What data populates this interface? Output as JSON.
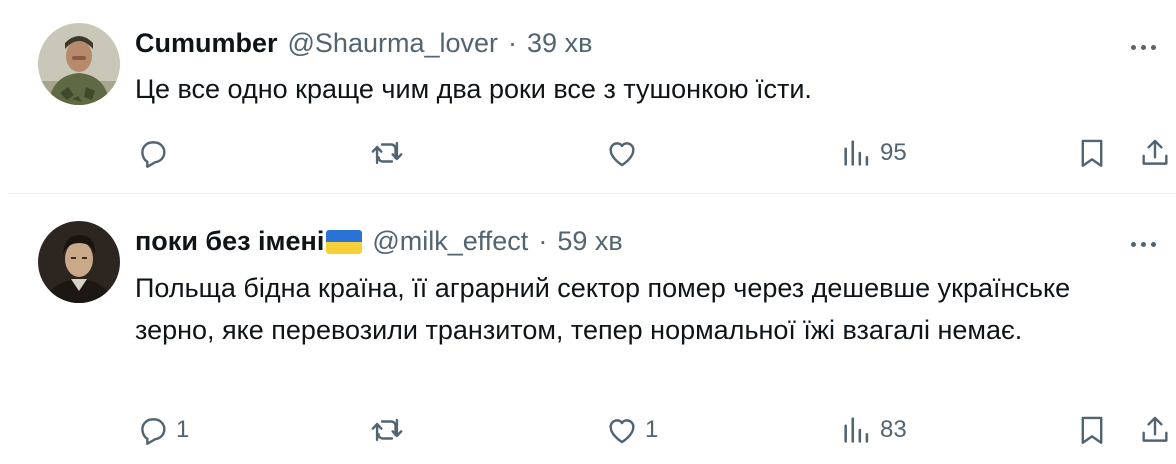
{
  "tweets": [
    {
      "display_name": "Cumumber",
      "handle": "@Shaurma_lover",
      "time": "39 хв",
      "text": "Це все одно краще чим два роки все з тушонкою їсти.",
      "replies": "",
      "retweets": "",
      "likes": "",
      "views": "95",
      "has_flag": false
    },
    {
      "display_name": "поки без імені",
      "handle": "@milk_effect",
      "time": "59 хв",
      "text": "Польща бідна країна, її аграрний сектор помер через дешевше українське зерно, яке перевозили транзитом, тепер нормальної їжі взагалі немає.",
      "replies": "1",
      "retweets": "",
      "likes": "1",
      "views": "83",
      "has_flag": true
    }
  ],
  "icons": {
    "reply": "reply-icon",
    "retweet": "retweet-icon",
    "like": "heart-icon",
    "views": "views-chart-icon",
    "bookmark": "bookmark-icon",
    "share": "share-icon",
    "more": "more-dots-icon",
    "flag": "ukraine-flag-icon"
  },
  "colors": {
    "text_primary": "#0f1419",
    "text_secondary": "#536471",
    "divider": "#eff3f4",
    "flag_blue": "#2b72d8",
    "flag_yellow": "#f7d038"
  }
}
